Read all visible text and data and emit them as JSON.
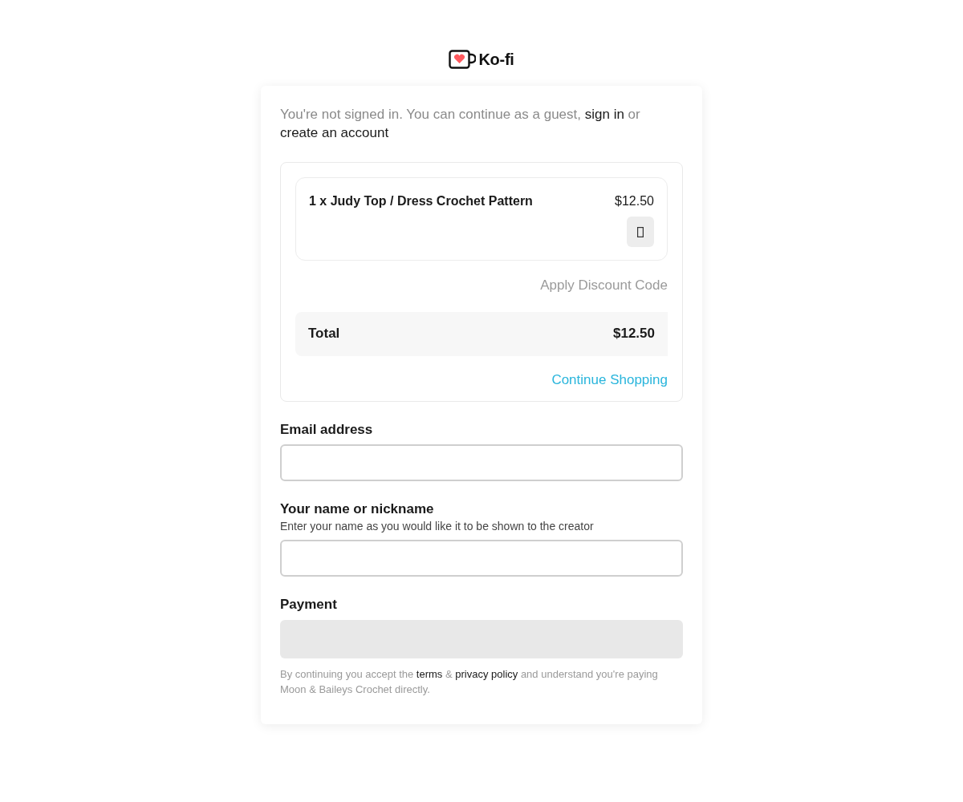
{
  "logo": {
    "wordmark": "Ko-fi"
  },
  "notice": [
    {
      "kind": "plain",
      "text": "You're not signed in. You can continue as a guest, "
    },
    {
      "kind": "link",
      "text": "sign in"
    },
    {
      "kind": "plain",
      "text": " or "
    },
    {
      "kind": "link",
      "text": "create an account"
    }
  ],
  "cart": {
    "items": [
      {
        "title": "1 x Judy Top / Dress Crochet Pattern",
        "price": "$12.50"
      }
    ],
    "discount_link": "Apply Discount Code",
    "total": {
      "label": "Total",
      "amount": "$12.50"
    },
    "continue_link": "Continue Shopping"
  },
  "fields": [
    {
      "label": "Email address"
    },
    {
      "label": "Your name or nickname",
      "help": "Enter your name as you would like it to be shown to the creator"
    }
  ],
  "payment": {
    "label": "Payment"
  },
  "footer": [
    {
      "kind": "plain",
      "text": "By continuing you accept the "
    },
    {
      "kind": "link",
      "text": "terms"
    },
    {
      "kind": "plain",
      "text": " & "
    },
    {
      "kind": "link",
      "text": "privacy policy"
    },
    {
      "kind": "plain",
      "text": " and understand you're paying Moon & Baileys Crochet directly."
    }
  ]
}
